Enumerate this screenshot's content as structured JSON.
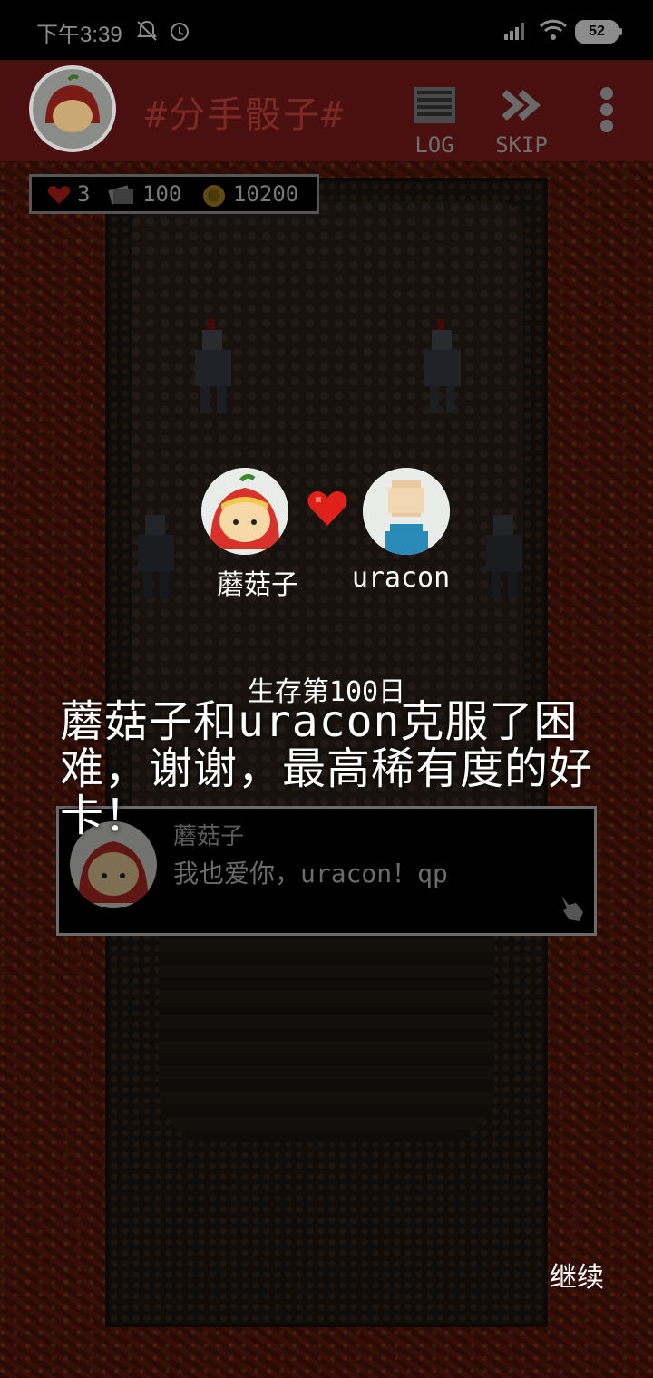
{
  "status_bar": {
    "time": "下午3:39",
    "battery": "52",
    "icons": [
      "mute-icon",
      "alarm-icon",
      "signal-icon",
      "wifi-icon",
      "battery-icon"
    ]
  },
  "header": {
    "title": "#分手骰子#",
    "log_label": "LOG",
    "skip_label": "SKIP"
  },
  "stats": {
    "hearts": "3",
    "cards": "100",
    "coins": "10200"
  },
  "couple": {
    "left_name": "蘑菇子",
    "right_name": "uracon"
  },
  "message": {
    "subtitle": "生存第100日",
    "text": "蘑菇子和uracon克服了困难，谢谢，最高稀有度的好卡！"
  },
  "dialog": {
    "speaker": "蘑菇子",
    "line": "我也爱你，uracon！qp"
  },
  "continue_label": "继续",
  "colors": {
    "header_bg": "#4a0f0f",
    "lava": "#5a1a0c",
    "heart": "#e0201a"
  }
}
